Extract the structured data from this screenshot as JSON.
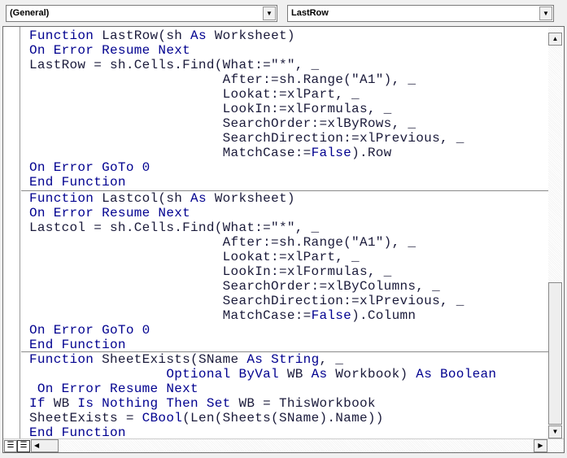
{
  "header": {
    "object_dropdown": "(General)",
    "procedure_dropdown": "LastRow"
  },
  "icons": {
    "dropdown": "chevron-down-icon",
    "scroll_up": "arrow-up-icon",
    "scroll_down": "arrow-down-icon",
    "scroll_left": "arrow-left-icon",
    "scroll_right": "arrow-right-icon",
    "procedure_view": "procedure-view-icon",
    "full_module_view": "full-module-view-icon"
  },
  "colors": {
    "keyword": "#00008f",
    "text": "#1a1a3a"
  },
  "code": {
    "procedures": [
      [
        [
          [
            "Function",
            "k"
          ],
          [
            " LastRow(sh ",
            ""
          ],
          [
            "As",
            "k"
          ],
          [
            " Worksheet)",
            ""
          ]
        ],
        [
          [
            "On Error Resume Next",
            "k"
          ]
        ],
        [
          [
            "LastRow = sh.Cells.Find(What:=\"*\", _",
            ""
          ]
        ],
        [
          [
            "                        After:=sh.Range(\"A1\"), _",
            ""
          ]
        ],
        [
          [
            "                        Lookat:=xlPart, _",
            ""
          ]
        ],
        [
          [
            "                        LookIn:=xlFormulas, _",
            ""
          ]
        ],
        [
          [
            "                        SearchOrder:=xlByRows, _",
            ""
          ]
        ],
        [
          [
            "                        SearchDirection:=xlPrevious, _",
            ""
          ]
        ],
        [
          [
            "                        MatchCase:=",
            ""
          ],
          [
            "False",
            "k"
          ],
          [
            ").Row",
            ""
          ]
        ],
        [
          [
            "On Error GoTo 0",
            "k"
          ]
        ],
        [
          [
            "End Function",
            "k"
          ]
        ]
      ],
      [
        [
          [
            "Function",
            "k"
          ],
          [
            " Lastcol(sh ",
            ""
          ],
          [
            "As",
            "k"
          ],
          [
            " Worksheet)",
            ""
          ]
        ],
        [
          [
            "On Error Resume Next",
            "k"
          ]
        ],
        [
          [
            "Lastcol = sh.Cells.Find(What:=\"*\", _",
            ""
          ]
        ],
        [
          [
            "                        After:=sh.Range(\"A1\"), _",
            ""
          ]
        ],
        [
          [
            "                        Lookat:=xlPart, _",
            ""
          ]
        ],
        [
          [
            "                        LookIn:=xlFormulas, _",
            ""
          ]
        ],
        [
          [
            "                        SearchOrder:=xlByColumns, _",
            ""
          ]
        ],
        [
          [
            "                        SearchDirection:=xlPrevious, _",
            ""
          ]
        ],
        [
          [
            "                        MatchCase:=",
            ""
          ],
          [
            "False",
            "k"
          ],
          [
            ").Column",
            ""
          ]
        ],
        [
          [
            "On Error GoTo 0",
            "k"
          ]
        ],
        [
          [
            "End Function",
            "k"
          ]
        ]
      ],
      [
        [
          [
            "Function",
            "k"
          ],
          [
            " SheetExists(SName ",
            ""
          ],
          [
            "As String",
            "k"
          ],
          [
            ", _",
            ""
          ]
        ],
        [
          [
            "                 ",
            ""
          ],
          [
            "Optional ByVal",
            "k"
          ],
          [
            " WB ",
            ""
          ],
          [
            "As",
            "k"
          ],
          [
            " Workbook) ",
            ""
          ],
          [
            "As Boolean",
            "k"
          ]
        ],
        [
          [
            " On Error Resume Next",
            "k"
          ]
        ],
        [
          [
            "If",
            "k"
          ],
          [
            " WB ",
            ""
          ],
          [
            "Is Nothing Then Set",
            "k"
          ],
          [
            " WB = ThisWorkbook",
            ""
          ]
        ],
        [
          [
            "SheetExists = ",
            ""
          ],
          [
            "CBool",
            "k"
          ],
          [
            "(Len(Sheets(SName).Name))",
            ""
          ]
        ],
        [
          [
            "End Function",
            "k"
          ]
        ]
      ]
    ]
  }
}
